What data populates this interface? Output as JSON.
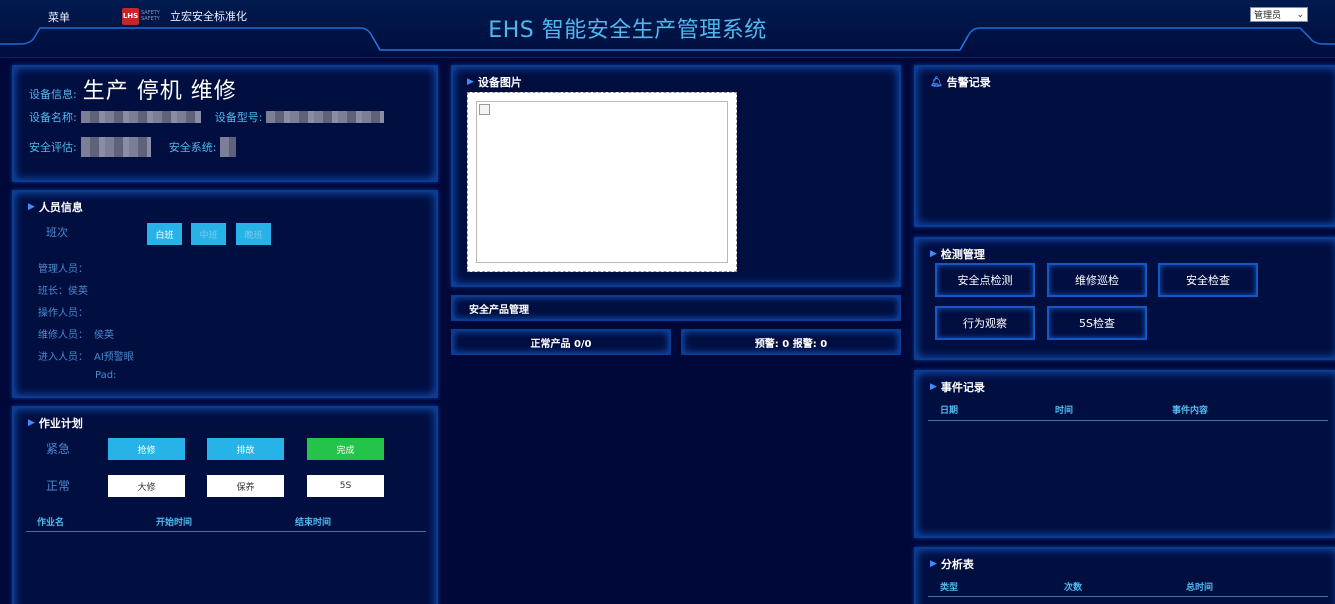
{
  "header": {
    "menu": "菜单",
    "brand_badge": "LHS",
    "brand_word": "SAFETY SAFETY",
    "brand_name": "立宏安全标准化",
    "title": "EHS 智能安全生产管理系统",
    "user": "管理员"
  },
  "device": {
    "info_label": "设备信息:",
    "status": "生产 停机 维修",
    "name_label": "设备名称:",
    "model_label": "设备型号:",
    "assess_label": "安全评估:",
    "system_label": "安全系统:"
  },
  "personnel": {
    "title": "人员信息",
    "shift_label": "班次",
    "shifts": [
      "白班",
      "中班",
      "晚班"
    ],
    "rows": [
      {
        "label": "管理人员：",
        "value": ""
      },
      {
        "label": "班长：",
        "value": "侯英"
      },
      {
        "label": "操作人员：",
        "value": ""
      },
      {
        "label": "维修人员：",
        "value": "侯英"
      },
      {
        "label": "进入人员：",
        "value": "AI预警眼"
      },
      {
        "label": "",
        "value": "Pad:"
      }
    ]
  },
  "plan": {
    "title": "作业计划",
    "urgent_label": "紧急",
    "normal_label": "正常",
    "urgent_buttons": [
      "抢修",
      "排故",
      "完成"
    ],
    "normal_buttons": [
      "大修",
      "保养",
      "5S"
    ],
    "columns": [
      "作业名",
      "开始时间",
      "结束时间"
    ]
  },
  "image_panel": {
    "title": "设备图片"
  },
  "product": {
    "title": "安全产品管理",
    "normal": "正常产品 0/0",
    "warn": "预警: 0 报警:  0"
  },
  "alarm": {
    "title": "告警记录"
  },
  "detect": {
    "title": "检测管理",
    "buttons": [
      "安全点检测",
      "维修巡检",
      "安全检查",
      "行为观察",
      "5S检查"
    ]
  },
  "events": {
    "title": "事件记录",
    "columns": [
      "日期",
      "时间",
      "事件内容"
    ]
  },
  "analysis": {
    "title": "分析表",
    "columns": [
      "类型",
      "次数",
      "总时间"
    ]
  },
  "colors": {
    "background": "#00083a",
    "panel_border": "#0a3d91",
    "accent_blue": "#27b3e8",
    "accent_green": "#24c44b",
    "title_blue": "#4fb9ee"
  }
}
